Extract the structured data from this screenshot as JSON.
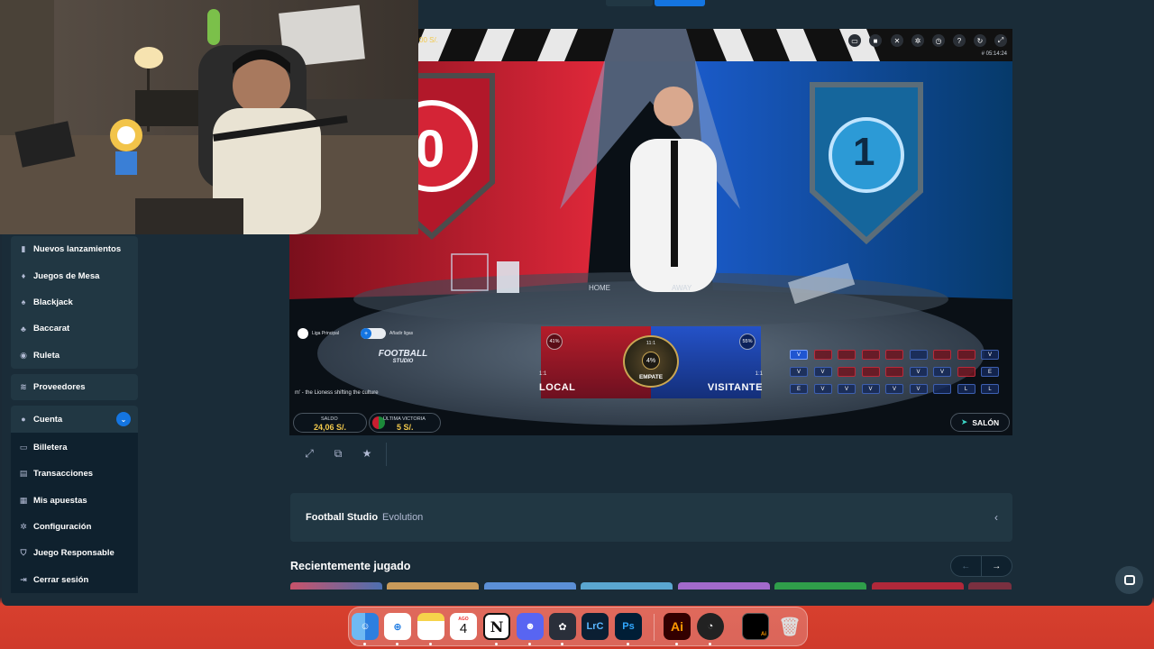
{
  "sidebar": {
    "group1": [
      {
        "label": "Nuevos lanzamientos",
        "icon": "bookmark-icon"
      },
      {
        "label": "Juegos de Mesa",
        "icon": "dice-icon"
      },
      {
        "label": "Blackjack",
        "icon": "spade-icon"
      },
      {
        "label": "Baccarat",
        "icon": "club-icon"
      },
      {
        "label": "Ruleta",
        "icon": "roulette-icon"
      }
    ],
    "providers": {
      "label": "Proveedores",
      "icon": "provider-icon"
    },
    "account": {
      "label": "Cuenta",
      "icon": "user-icon",
      "expanded_glyph": "⌄"
    },
    "account_items": [
      {
        "label": "Billetera",
        "icon": "wallet-icon"
      },
      {
        "label": "Transacciones",
        "icon": "transactions-icon"
      },
      {
        "label": "Mis apuestas",
        "icon": "bets-icon"
      },
      {
        "label": "Configuración",
        "icon": "gear-icon"
      },
      {
        "label": "Juego Responsable",
        "icon": "shield-icon"
      },
      {
        "label": "Cerrar sesión",
        "icon": "logout-icon"
      }
    ]
  },
  "game": {
    "partial_balance_text": "00 S/.",
    "clock": "# 05:14:24",
    "table_home": "HOME",
    "table_away": "AWAY",
    "scoreboard_left": "0",
    "scoreboard_right": "1",
    "local": {
      "label": "LOCAL",
      "ratio": "1:1",
      "pct": "41%"
    },
    "visitor": {
      "label": "VISITANTE",
      "ratio": "1:1",
      "pct": "55%"
    },
    "draw": {
      "label": "EMPATE",
      "ratio": "11:1",
      "pct": "4%"
    },
    "league_label": "Liga Principal",
    "add_league_label": "Añadir ligas",
    "logo_line1": "FOOTBALL",
    "logo_line2": "STUDIO",
    "ticker": "m' - the Lioness shifting the culture",
    "balance": {
      "label": "SALDO",
      "value": "24,06 S/."
    },
    "last_win": {
      "label": "ÚLTIMA VICTORIA",
      "value": "5 S/."
    },
    "lobby_label": "SALÓN",
    "history_rows": [
      [
        "V",
        "",
        "",
        "",
        "",
        "",
        "",
        "",
        "V"
      ],
      [
        "V",
        "V",
        "",
        "",
        "",
        "V",
        "V",
        "",
        "E"
      ],
      [
        "E",
        "V",
        "V",
        "V",
        "V",
        "V",
        "",
        "L",
        "L"
      ]
    ]
  },
  "description": {
    "title": "Football Studio",
    "provider": "Evolution",
    "chevron": "‹"
  },
  "recent": {
    "title": "Recientemente jugado",
    "prev": "←",
    "next": "→"
  },
  "dock": {
    "calendar_month": "AGO",
    "calendar_day": "4",
    "notion": "N",
    "lightroom": "LrC",
    "photoshop": "Ps",
    "illustrator": "Ai",
    "ai_tile": "Ai"
  },
  "colors": {
    "sidebar_bg": "#213743",
    "app_bg": "#1a2c38",
    "accent_blue": "#1475e1",
    "desktop_red": "#cf3a2b"
  }
}
